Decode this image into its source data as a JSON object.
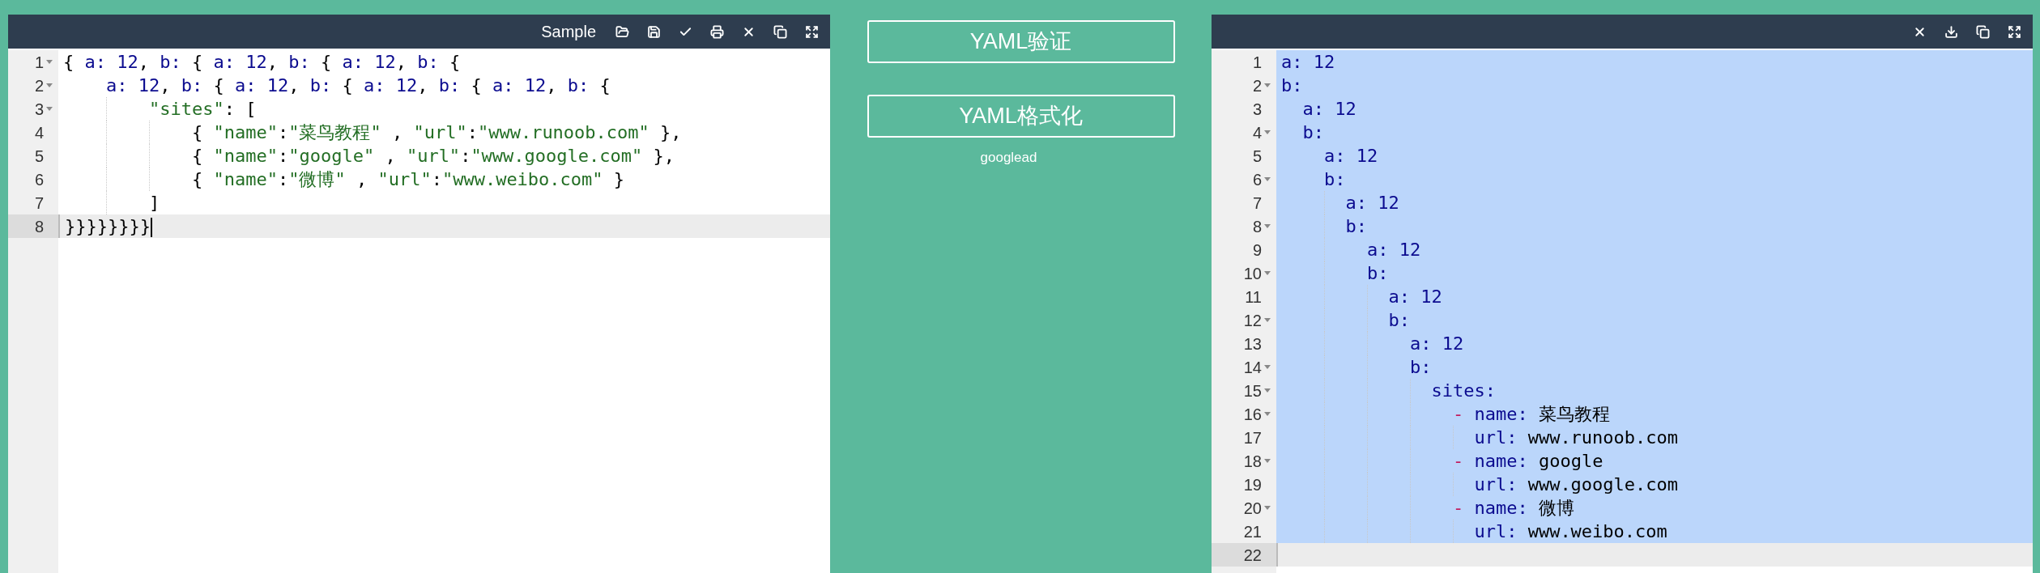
{
  "input_editor": {
    "toolbar": {
      "title": "Sample"
    },
    "lines": [
      {
        "number": "1",
        "fold": true,
        "active": false,
        "tokens": [
          {
            "kind": "plain",
            "text": "{ "
          },
          {
            "kind": "ident",
            "text": "a: 12"
          },
          {
            "kind": "plain",
            "text": ", "
          },
          {
            "kind": "ident",
            "text": "b: "
          },
          {
            "kind": "plain",
            "text": "{ "
          },
          {
            "kind": "ident",
            "text": "a: 12"
          },
          {
            "kind": "plain",
            "text": ", "
          },
          {
            "kind": "ident",
            "text": "b: "
          },
          {
            "kind": "plain",
            "text": "{ "
          },
          {
            "kind": "ident",
            "text": "a: 12"
          },
          {
            "kind": "plain",
            "text": ", "
          },
          {
            "kind": "ident",
            "text": "b: "
          },
          {
            "kind": "plain",
            "text": "{"
          }
        ]
      },
      {
        "number": "2",
        "fold": true,
        "active": false,
        "tokens": [
          {
            "kind": "ident",
            "text": "    a: 12"
          },
          {
            "kind": "plain",
            "text": ", "
          },
          {
            "kind": "ident",
            "text": "b: "
          },
          {
            "kind": "plain",
            "text": "{ "
          },
          {
            "kind": "ident",
            "text": "a: 12"
          },
          {
            "kind": "plain",
            "text": ", "
          },
          {
            "kind": "ident",
            "text": "b: "
          },
          {
            "kind": "plain",
            "text": "{ "
          },
          {
            "kind": "ident",
            "text": "a: 12"
          },
          {
            "kind": "plain",
            "text": ", "
          },
          {
            "kind": "ident",
            "text": "b: "
          },
          {
            "kind": "plain",
            "text": "{ "
          },
          {
            "kind": "ident",
            "text": "a: 12"
          },
          {
            "kind": "plain",
            "text": ", "
          },
          {
            "kind": "ident",
            "text": "b: "
          },
          {
            "kind": "plain",
            "text": "{"
          }
        ]
      },
      {
        "number": "3",
        "fold": true,
        "active": false,
        "tokens": [
          {
            "kind": "string",
            "text": "        \"sites\""
          },
          {
            "kind": "plain",
            "text": ": ["
          }
        ]
      },
      {
        "number": "4",
        "fold": false,
        "active": false,
        "tokens": [
          {
            "kind": "plain",
            "text": "            { "
          },
          {
            "kind": "string",
            "text": "\"name\""
          },
          {
            "kind": "plain",
            "text": ":"
          },
          {
            "kind": "string",
            "text": "\"菜鸟教程\""
          },
          {
            "kind": "plain",
            "text": " , "
          },
          {
            "kind": "string",
            "text": "\"url\""
          },
          {
            "kind": "plain",
            "text": ":"
          },
          {
            "kind": "string",
            "text": "\"www.runoob.com\""
          },
          {
            "kind": "plain",
            "text": " },"
          }
        ]
      },
      {
        "number": "5",
        "fold": false,
        "active": false,
        "tokens": [
          {
            "kind": "plain",
            "text": "            { "
          },
          {
            "kind": "string",
            "text": "\"name\""
          },
          {
            "kind": "plain",
            "text": ":"
          },
          {
            "kind": "string",
            "text": "\"google\""
          },
          {
            "kind": "plain",
            "text": " , "
          },
          {
            "kind": "string",
            "text": "\"url\""
          },
          {
            "kind": "plain",
            "text": ":"
          },
          {
            "kind": "string",
            "text": "\"www.google.com\""
          },
          {
            "kind": "plain",
            "text": " },"
          }
        ]
      },
      {
        "number": "6",
        "fold": false,
        "active": false,
        "tokens": [
          {
            "kind": "plain",
            "text": "            { "
          },
          {
            "kind": "string",
            "text": "\"name\""
          },
          {
            "kind": "plain",
            "text": ":"
          },
          {
            "kind": "string",
            "text": "\"微博\""
          },
          {
            "kind": "plain",
            "text": " , "
          },
          {
            "kind": "string",
            "text": "\"url\""
          },
          {
            "kind": "plain",
            "text": ":"
          },
          {
            "kind": "string",
            "text": "\"www.weibo.com\""
          },
          {
            "kind": "plain",
            "text": " }"
          }
        ]
      },
      {
        "number": "7",
        "fold": false,
        "active": false,
        "tokens": [
          {
            "kind": "plain",
            "text": "        ]"
          }
        ]
      },
      {
        "number": "8",
        "fold": false,
        "active": true,
        "tokens": [
          {
            "kind": "plain",
            "text": "}}}}}}}}"
          }
        ]
      }
    ]
  },
  "actions": {
    "buttons": [
      "YAML验证",
      "YAML格式化"
    ],
    "ad_label": "googlead"
  },
  "output_editor": {
    "lines": [
      {
        "number": "1",
        "fold": false,
        "selected": true,
        "active": false,
        "tokens": [
          {
            "kind": "ident",
            "text": "a: 12"
          }
        ]
      },
      {
        "number": "2",
        "fold": true,
        "selected": true,
        "active": false,
        "tokens": [
          {
            "kind": "ident",
            "text": "b:"
          }
        ]
      },
      {
        "number": "3",
        "fold": false,
        "selected": true,
        "active": false,
        "tokens": [
          {
            "kind": "ident",
            "text": "  a: 12"
          }
        ]
      },
      {
        "number": "4",
        "fold": true,
        "selected": true,
        "active": false,
        "tokens": [
          {
            "kind": "ident",
            "text": "  b:"
          }
        ]
      },
      {
        "number": "5",
        "fold": false,
        "selected": true,
        "active": false,
        "tokens": [
          {
            "kind": "ident",
            "text": "    a: 12"
          }
        ]
      },
      {
        "number": "6",
        "fold": true,
        "selected": true,
        "active": false,
        "tokens": [
          {
            "kind": "ident",
            "text": "    b:"
          }
        ]
      },
      {
        "number": "7",
        "fold": false,
        "selected": true,
        "active": false,
        "tokens": [
          {
            "kind": "ident",
            "text": "      a: 12"
          }
        ]
      },
      {
        "number": "8",
        "fold": true,
        "selected": true,
        "active": false,
        "tokens": [
          {
            "kind": "ident",
            "text": "      b:"
          }
        ]
      },
      {
        "number": "9",
        "fold": false,
        "selected": true,
        "active": false,
        "tokens": [
          {
            "kind": "ident",
            "text": "        a: 12"
          }
        ]
      },
      {
        "number": "10",
        "fold": true,
        "selected": true,
        "active": false,
        "tokens": [
          {
            "kind": "ident",
            "text": "        b:"
          }
        ]
      },
      {
        "number": "11",
        "fold": false,
        "selected": true,
        "active": false,
        "tokens": [
          {
            "kind": "ident",
            "text": "          a: 12"
          }
        ]
      },
      {
        "number": "12",
        "fold": true,
        "selected": true,
        "active": false,
        "tokens": [
          {
            "kind": "ident",
            "text": "          b:"
          }
        ]
      },
      {
        "number": "13",
        "fold": false,
        "selected": true,
        "active": false,
        "tokens": [
          {
            "kind": "ident",
            "text": "            a: 12"
          }
        ]
      },
      {
        "number": "14",
        "fold": true,
        "selected": true,
        "active": false,
        "tokens": [
          {
            "kind": "ident",
            "text": "            b:"
          }
        ]
      },
      {
        "number": "15",
        "fold": true,
        "selected": true,
        "active": false,
        "tokens": [
          {
            "kind": "ident",
            "text": "              sites:"
          }
        ]
      },
      {
        "number": "16",
        "fold": true,
        "selected": true,
        "active": false,
        "tokens": [
          {
            "kind": "dash",
            "text": "                - "
          },
          {
            "kind": "ident",
            "text": "name: "
          },
          {
            "kind": "plain",
            "text": "菜鸟教程"
          }
        ]
      },
      {
        "number": "17",
        "fold": false,
        "selected": true,
        "active": false,
        "tokens": [
          {
            "kind": "ident",
            "text": "                  url: "
          },
          {
            "kind": "plain",
            "text": "www.runoob.com"
          }
        ]
      },
      {
        "number": "18",
        "fold": true,
        "selected": true,
        "active": false,
        "tokens": [
          {
            "kind": "dash",
            "text": "                - "
          },
          {
            "kind": "ident",
            "text": "name: "
          },
          {
            "kind": "plain",
            "text": "google"
          }
        ]
      },
      {
        "number": "19",
        "fold": false,
        "selected": true,
        "active": false,
        "tokens": [
          {
            "kind": "ident",
            "text": "                  url: "
          },
          {
            "kind": "plain",
            "text": "www.google.com"
          }
        ]
      },
      {
        "number": "20",
        "fold": true,
        "selected": true,
        "active": false,
        "tokens": [
          {
            "kind": "dash",
            "text": "                - "
          },
          {
            "kind": "ident",
            "text": "name: "
          },
          {
            "kind": "plain",
            "text": "微博"
          }
        ]
      },
      {
        "number": "21",
        "fold": false,
        "selected": true,
        "active": false,
        "tokens": [
          {
            "kind": "ident",
            "text": "                  url: "
          },
          {
            "kind": "plain",
            "text": "www.weibo.com"
          }
        ]
      },
      {
        "number": "22",
        "fold": false,
        "selected": false,
        "active": true
      }
    ]
  }
}
